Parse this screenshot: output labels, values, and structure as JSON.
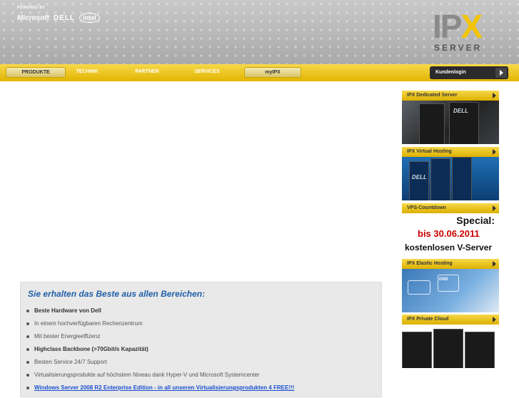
{
  "header": {
    "powered_by": "POWERED BY",
    "brands": [
      "Microsoft",
      "DELL",
      "intel"
    ],
    "logo": {
      "main": "IPX",
      "sub": "SERVER"
    }
  },
  "nav": {
    "tabs": [
      "PRODUKTE",
      "TECHNIK",
      "PARTNER",
      "SERVICES",
      "myIPX"
    ],
    "kundenlogin": "Kundenlogin"
  },
  "infobox": {
    "title": "Sie erhalten das Beste aus allen Bereichen:",
    "items": [
      "Beste Hardware von Dell",
      "In einem hochverfügbaren Rechenzentrum",
      "Mit bester Energieeffizenz",
      "Highclass Backbone (>70Gbit/s Kapazität)",
      "Besten Service 24/7 Support",
      "Virtualisierungsprodukte auf höchstem Niveau dank Hyper-V und Microsoft Systemcenter",
      "Windows Server 2008 R2 Enterprise Edition - in all unseren Virtualisierungsprodukten 4 FREE!!!"
    ]
  },
  "sidebar": {
    "items": [
      {
        "title": "IPX Dedicated Server",
        "image_text": "DELL"
      },
      {
        "title": "IPX Virtual Hosting",
        "image_text": "DELL"
      },
      {
        "title": "VPS-Countdown",
        "image_text": [
          "Special:",
          "bis 30.06.2011",
          "kostenlosen V-Server"
        ]
      },
      {
        "title": "IPX Elastic Hosting",
        "image_text": "DNS"
      },
      {
        "title": "IPX Private Cloud",
        "image_text": ""
      }
    ]
  },
  "colors": {
    "accent_yellow": "#f2c500",
    "title_blue": "#1f5fa8",
    "link_blue": "#1a4fd0",
    "special_red": "#cc0000"
  }
}
